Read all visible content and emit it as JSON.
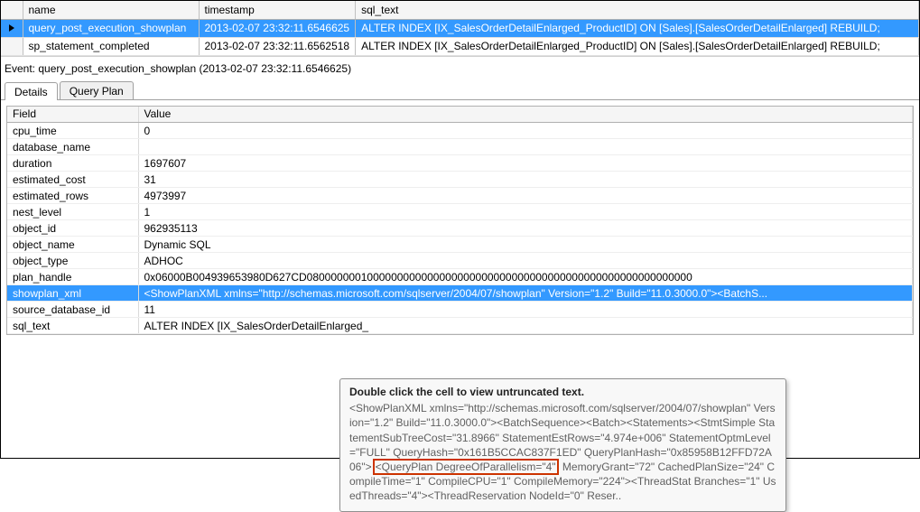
{
  "top_grid": {
    "headers": {
      "name": "name",
      "timestamp": "timestamp",
      "sql_text": "sql_text"
    },
    "rows": [
      {
        "name": "query_post_execution_showplan",
        "timestamp": "2013-02-07 23:32:11.6546625",
        "sql_text": "ALTER INDEX [IX_SalesOrderDetailEnlarged_ProductID] ON [Sales].[SalesOrderDetailEnlarged]  REBUILD;",
        "selected": true
      },
      {
        "name": "sp_statement_completed",
        "timestamp": "2013-02-07 23:32:11.6562518",
        "sql_text": "ALTER INDEX [IX_SalesOrderDetailEnlarged_ProductID] ON [Sales].[SalesOrderDetailEnlarged]  REBUILD;",
        "selected": false
      }
    ]
  },
  "event_label": "Event: query_post_execution_showplan (2013-02-07 23:32:11.6546625)",
  "tabs": {
    "details": "Details",
    "queryplan": "Query Plan"
  },
  "details": {
    "headers": {
      "field": "Field",
      "value": "Value"
    },
    "rows": [
      {
        "field": "cpu_time",
        "value": "0"
      },
      {
        "field": "database_name",
        "value": ""
      },
      {
        "field": "duration",
        "value": "1697607"
      },
      {
        "field": "estimated_cost",
        "value": "31"
      },
      {
        "field": "estimated_rows",
        "value": "4973997"
      },
      {
        "field": "nest_level",
        "value": "1"
      },
      {
        "field": "object_id",
        "value": "962935113"
      },
      {
        "field": "object_name",
        "value": "Dynamic SQL"
      },
      {
        "field": "object_type",
        "value": "ADHOC"
      },
      {
        "field": "plan_handle",
        "value": "0x06000B004939653980D627CD0800000001000000000000000000000000000000000000000000000000000000"
      },
      {
        "field": "showplan_xml",
        "value": "<ShowPlanXML xmlns=\"http://schemas.microsoft.com/sqlserver/2004/07/showplan\" Version=\"1.2\" Build=\"11.0.3000.0\"><BatchS...",
        "selected": true
      },
      {
        "field": "source_database_id",
        "value": "11"
      },
      {
        "field": "sql_text",
        "value": "ALTER INDEX [IX_SalesOrderDetailEnlarged_"
      }
    ]
  },
  "tooltip": {
    "title": "Double click the cell to view untruncated text.",
    "pre": "<ShowPlanXML xmlns=\"http://schemas.microsoft.com/sqlserver/2004/07/showplan\" Version=\"1.2\" Build=\"11.0.3000.0\"><BatchSequence><Batch><Statements><StmtSimple StatementSubTreeCost=\"31.8966\" StatementEstRows=\"4.974e+006\" StatementOptmLevel=\"FULL\" QueryHash=\"0x161B5CCAC837F1ED\" QueryPlanHash=\"0x85958B12FFD72A06\">",
    "highlight": "<QueryPlan DegreeOfParallelism=\"4\"",
    "post": " MemoryGrant=\"72\" CachedPlanSize=\"24\" CompileTime=\"1\" CompileCPU=\"1\" CompileMemory=\"224\"><ThreadStat Branches=\"1\" UsedThreads=\"4\"><ThreadReservation NodeId=\"0\" Reser.."
  }
}
